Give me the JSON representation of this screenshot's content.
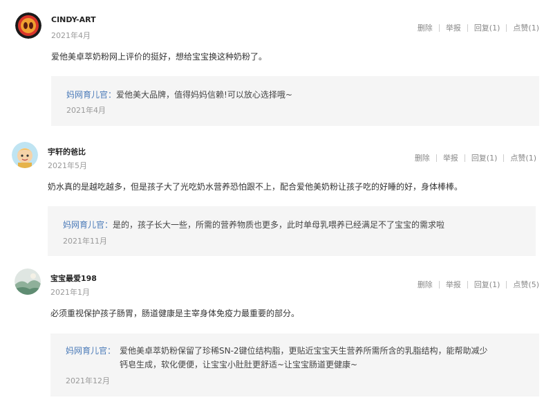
{
  "comments": [
    {
      "username": "CINDY-ART",
      "date": "2021年4月",
      "text": "爱他美卓萃奶粉网上评价的挺好，想给宝宝换这种奶粉了。",
      "actions": {
        "delete": "删除",
        "report": "举报",
        "reply": "回复(1)",
        "like": "点赞(1)"
      },
      "reply": {
        "author": "妈网育儿官：",
        "lines": [
          "爱他美大品牌，值得妈妈信赖!可以放心选择哦~"
        ],
        "date": "2021年4月"
      }
    },
    {
      "username": "宇轩的爸比",
      "date": "2021年5月",
      "text": "奶水真的是越吃越多，但是孩子大了光吃奶水营养恐怕跟不上，配合爱他美奶粉让孩子吃的好睡的好，身体棒棒。",
      "actions": {
        "delete": "删除",
        "report": "举报",
        "reply": "回复(1)",
        "like": "点赞(1)"
      },
      "reply": {
        "author": "妈网育儿官：",
        "lines": [
          "是的，孩子长大一些，所需的营养物质也更多，此时单母乳喂养已经满足不了宝宝的需求啦"
        ],
        "date": "2021年11月"
      }
    },
    {
      "username": "宝宝最爱198",
      "date": "2021年1月",
      "text": "必须重视保护孩子肠胃，肠道健康是主宰身体免疫力最重要的部分。",
      "actions": {
        "delete": "删除",
        "report": "举报",
        "reply": "回复(1)",
        "like": "点赞(5)"
      },
      "reply": {
        "author": "妈网育儿官：",
        "lines": [
          "爱他美卓萃奶粉保留了珍稀SN-2键位结构脂，更贴近宝宝天生营养所需所含的乳脂结构，能帮助减少",
          "钙皂生成，软化便便，让宝宝小肚肚更舒适~让宝宝肠道更健康~"
        ],
        "date": "2021年12月"
      }
    }
  ],
  "colors": {
    "link_blue": "#4a7ab8",
    "reply_bg": "#f5f5f5",
    "muted_gray": "#999999",
    "action_gray": "#888888"
  },
  "avatar_icons": [
    "circle-logo-avatar",
    "cartoon-child-avatar",
    "landscape-photo-avatar"
  ]
}
